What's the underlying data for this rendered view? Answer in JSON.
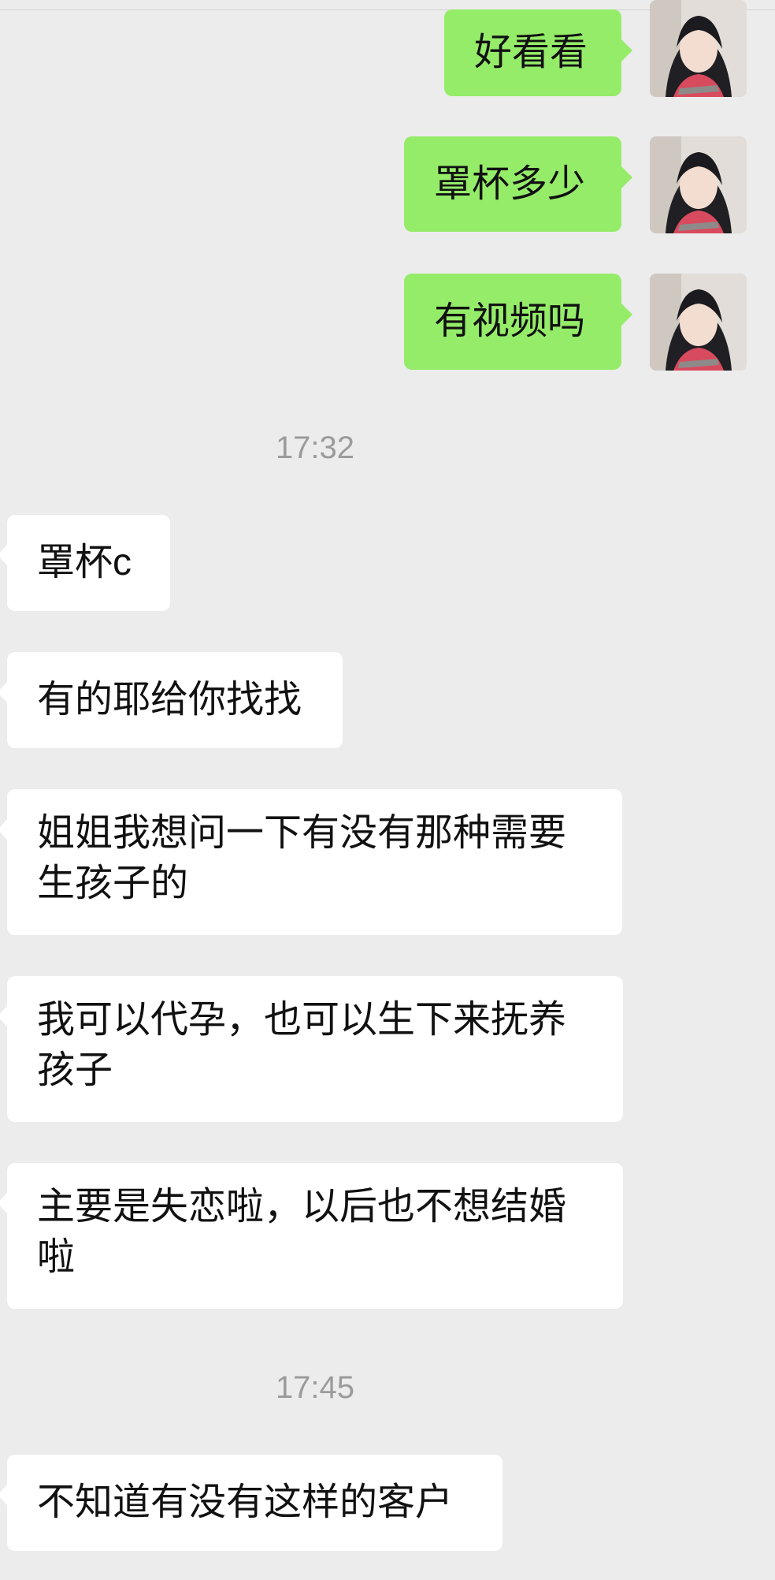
{
  "conversation": {
    "outgoing": [
      {
        "text": "好看看"
      },
      {
        "text": "罩杯多少"
      },
      {
        "text": "有视频吗"
      }
    ],
    "timestamps": [
      "17:32",
      "17:45"
    ],
    "incoming": [
      {
        "text": "罩杯c"
      },
      {
        "text": "有的耶给你找找"
      },
      {
        "text": "姐姐我想问一下有没有那种需要生孩子的"
      },
      {
        "text": "我可以代孕，也可以生下来抚养孩子"
      },
      {
        "text": "主要是失恋啦，以后也不想结婚啦"
      },
      {
        "text": "不知道有没有这样的客户"
      }
    ]
  },
  "colors": {
    "background": "#ececec",
    "outgoing_bubble": "#95ec69",
    "incoming_bubble": "#ffffff",
    "timestamp_text": "#9b9b9b"
  },
  "icons": {
    "avatar": "user-avatar-icon"
  }
}
